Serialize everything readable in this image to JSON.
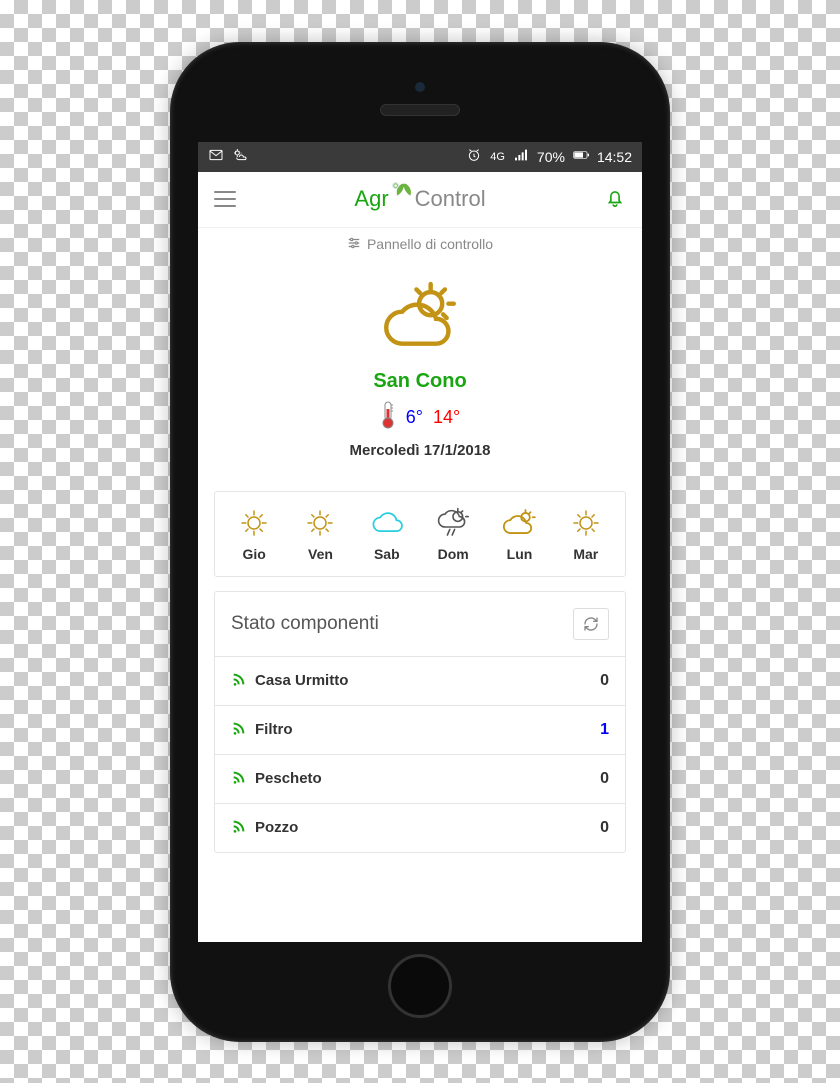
{
  "status_bar": {
    "network": "4G",
    "battery_text": "70%",
    "time": "14:52"
  },
  "brand": {
    "part1": "Agr",
    "part2": "Control"
  },
  "panel_label": "Pannello di controllo",
  "weather": {
    "city": "San Cono",
    "low": "6°",
    "high": "14°",
    "date": "Mercoledì 17/1/2018"
  },
  "forecast": [
    {
      "label": "Gio",
      "icon": "sun"
    },
    {
      "label": "Ven",
      "icon": "sun"
    },
    {
      "label": "Sab",
      "icon": "cloud-cyan"
    },
    {
      "label": "Dom",
      "icon": "storm"
    },
    {
      "label": "Lun",
      "icon": "cloud-sun-gold"
    },
    {
      "label": "Mar",
      "icon": "sun"
    }
  ],
  "components_title": "Stato componenti",
  "components": [
    {
      "name": "Casa Urmitto",
      "value": "0",
      "active": false
    },
    {
      "name": "Filtro",
      "value": "1",
      "active": true
    },
    {
      "name": "Pescheto",
      "value": "0",
      "active": false
    },
    {
      "name": "Pozzo",
      "value": "0",
      "active": false
    }
  ]
}
